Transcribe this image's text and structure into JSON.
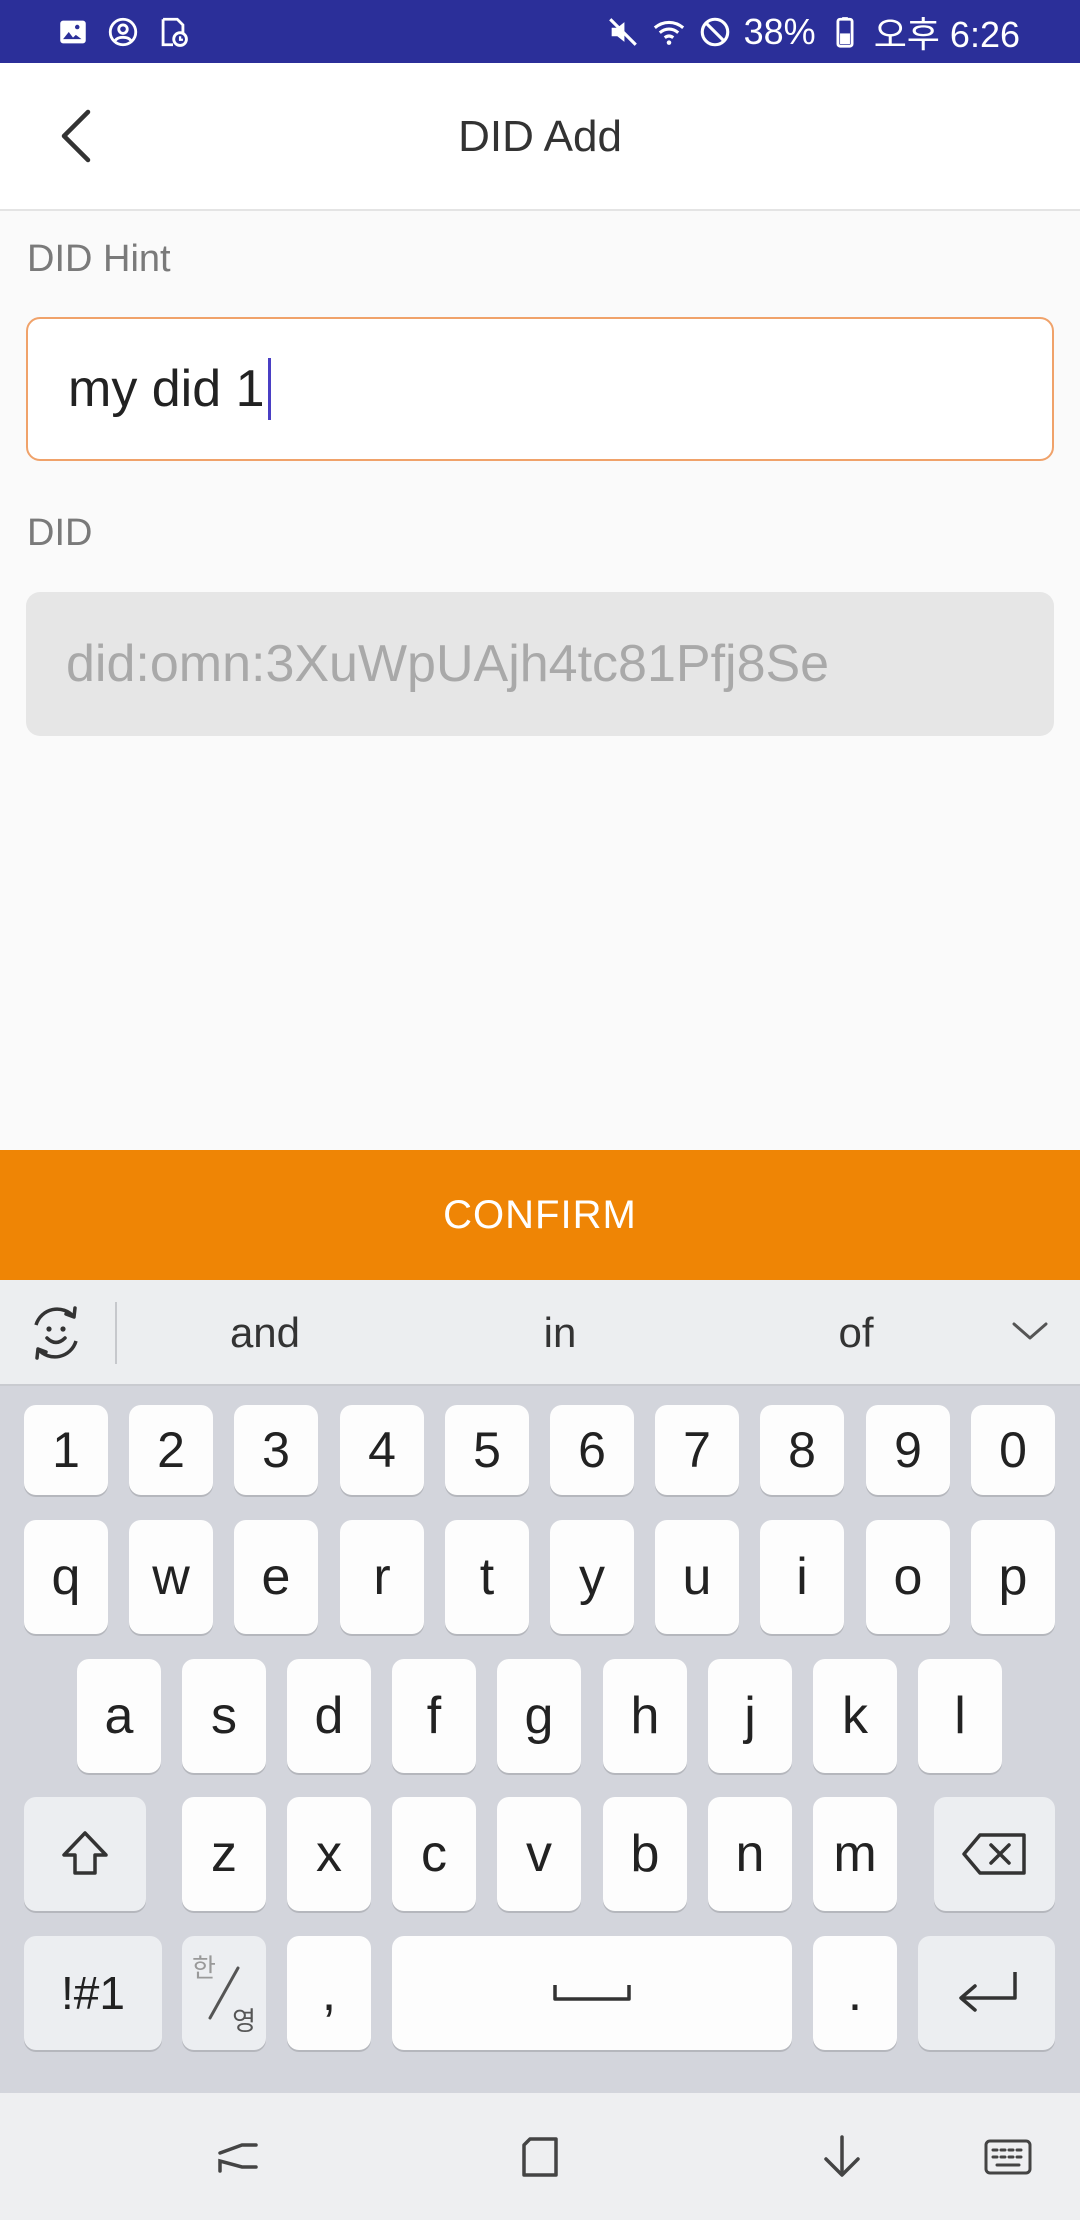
{
  "status_bar": {
    "battery": "38%",
    "time": "오후 6:26",
    "background_color": "#2b2f99",
    "left_icons": [
      "gallery-icon",
      "account-icon",
      "file-clock-icon"
    ],
    "right_icons": [
      "mute-icon",
      "wifi-icon",
      "do-not-disturb-icon",
      "battery-icon"
    ]
  },
  "header": {
    "title": "DID Add",
    "back_icon": "chevron-left-icon"
  },
  "form": {
    "hint_label": "DID Hint",
    "hint_value": "my did 1",
    "did_label": "DID",
    "did_value": "did:omn:3XuWpUAjh4tc81Pfj8Se"
  },
  "confirm": {
    "label": "CONFIRM",
    "color": "#ef8505"
  },
  "keyboard": {
    "suggestions": [
      "and",
      "in",
      "of"
    ],
    "number_row": [
      "1",
      "2",
      "3",
      "4",
      "5",
      "6",
      "7",
      "8",
      "9",
      "0"
    ],
    "row1": [
      "q",
      "w",
      "e",
      "r",
      "t",
      "y",
      "u",
      "i",
      "o",
      "p"
    ],
    "row2": [
      "a",
      "s",
      "d",
      "f",
      "g",
      "h",
      "j",
      "k",
      "l"
    ],
    "row3": [
      "z",
      "x",
      "c",
      "v",
      "b",
      "n",
      "m"
    ],
    "symbols_label": "!#1",
    "lang_top": "한",
    "lang_bottom": "영",
    "comma": ",",
    "period": "."
  }
}
